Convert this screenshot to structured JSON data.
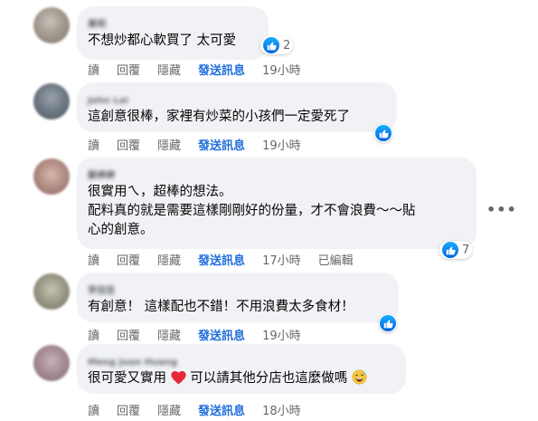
{
  "actions": {
    "read": "讀",
    "reply": "回覆",
    "hide": "隱藏",
    "send": "發送訊息",
    "edited": "已編輯"
  },
  "comments": [
    {
      "name": "黃明",
      "text": "不想炒都心軟買了 太可愛",
      "reaction_count": "2",
      "time": "19小時"
    },
    {
      "name": "John Lai",
      "text": "這創意很棒，家裡有炒菜的小孩們一定愛死了",
      "reaction_count": "",
      "time": "19小時"
    },
    {
      "name": "鄭婷婷",
      "text_line1": "很實用ㄟ，超棒的想法。",
      "text_line2": "配料真的就是需要這樣剛剛好的份量，才不會浪費～～貼",
      "text_line3": "心的創意。",
      "reaction_count": "7",
      "time": "17小時"
    },
    {
      "name": "李佳佳",
      "text": "有創意！ 這樣配也不錯！不用浪費太多食材！",
      "reaction_count": "",
      "time": "19小時"
    },
    {
      "name": "Meng Juan Huang",
      "text_before": "很可愛又實用",
      "text_after": "可以請其他分店也這麼做嗎",
      "reaction_count": "",
      "time": "18小時"
    }
  ],
  "icons": {
    "like": "like-icon",
    "heart": "heart-icon",
    "emoji": "grinning-sweat-icon",
    "more": "more-horizontal-icon"
  },
  "colors": {
    "send_link": "#216fdb",
    "bubble": "#f0f2f5",
    "like_blue": "#1877f2"
  }
}
